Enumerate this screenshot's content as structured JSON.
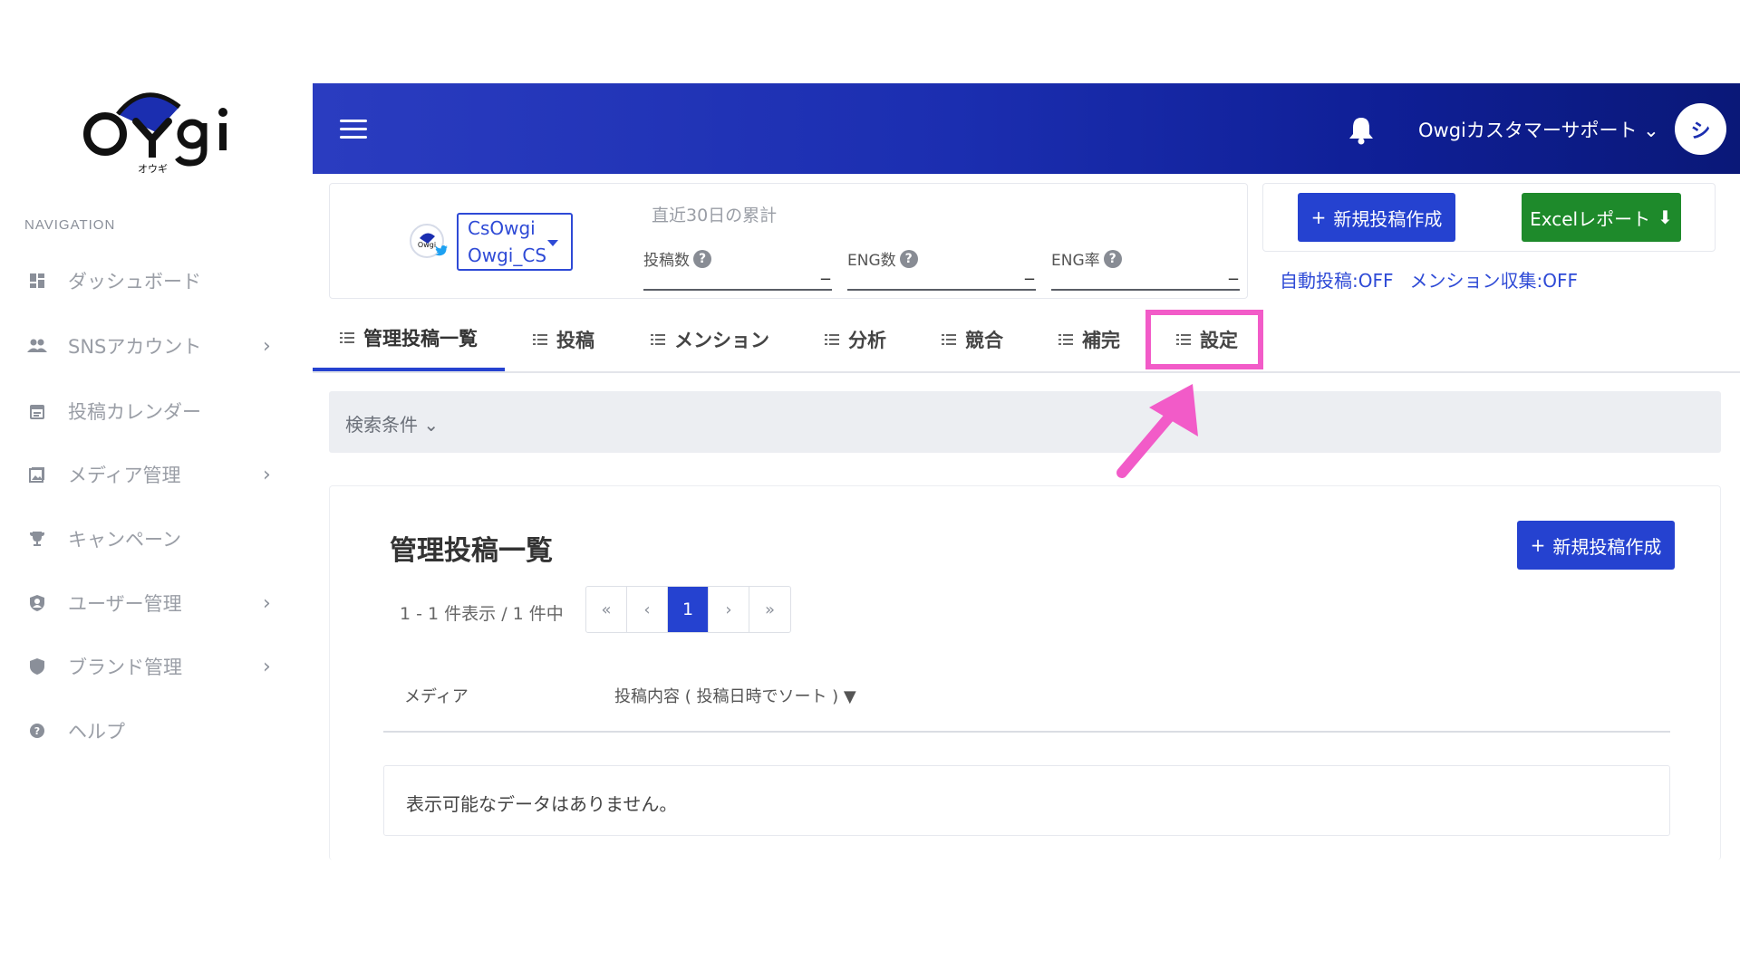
{
  "brand": {
    "logo_text": "Owgi",
    "logo_sub": "オウギ"
  },
  "sidebar": {
    "nav_title": "NAVIGATION",
    "items": [
      {
        "label": "ダッシュボード",
        "icon": "dashboard-icon",
        "has_children": false
      },
      {
        "label": "SNSアカウント",
        "icon": "people-icon",
        "has_children": true
      },
      {
        "label": "投稿カレンダー",
        "icon": "calendar-icon",
        "has_children": false
      },
      {
        "label": "メディア管理",
        "icon": "image-icon",
        "has_children": true
      },
      {
        "label": "キャンペーン",
        "icon": "trophy-icon",
        "has_children": false
      },
      {
        "label": "ユーザー管理",
        "icon": "user-shield-icon",
        "has_children": true
      },
      {
        "label": "ブランド管理",
        "icon": "shield-icon",
        "has_children": true
      },
      {
        "label": "ヘルプ",
        "icon": "help-icon",
        "has_children": false
      }
    ],
    "chevron": "›"
  },
  "header": {
    "user_name": "Owgiカスタマーサポート ⌄",
    "avatar_initial": "シ"
  },
  "account": {
    "name_line1": "CsOwgi",
    "name_line2": "Owgi_CS",
    "recent_label": "直近30日の累計",
    "metrics": [
      {
        "label": "投稿数",
        "value": "_"
      },
      {
        "label": "ENG数",
        "value": "_"
      },
      {
        "label": "ENG率",
        "value": "_"
      }
    ],
    "help_mark": "?"
  },
  "actions": {
    "new_post": "新規投稿作成",
    "excel_report": "Excelレポート",
    "plus": "+",
    "download": "⬇"
  },
  "status": {
    "auto_post": "自動投稿:OFF",
    "mention_collect": "メンション収集:OFF"
  },
  "tabs": [
    {
      "label": "管理投稿一覧",
      "active": true
    },
    {
      "label": "投稿",
      "active": false
    },
    {
      "label": "メンション",
      "active": false
    },
    {
      "label": "分析",
      "active": false
    },
    {
      "label": "競合",
      "active": false
    },
    {
      "label": "補完",
      "active": false
    },
    {
      "label": "設定",
      "active": false
    }
  ],
  "search": {
    "label": "検索条件 ⌄"
  },
  "list": {
    "title": "管理投稿一覧",
    "new_post": "新規投稿作成",
    "count_text": "1 - 1 件表示 / 1 件中",
    "pager": [
      "«",
      "‹",
      "1",
      "›",
      "»"
    ],
    "current_page": "1",
    "columns": [
      "メディア",
      "投稿内容 ( 投稿日時でソート ) ▼"
    ],
    "empty_message": "表示可能なデータはありません。"
  },
  "colors": {
    "primary": "#2542d0",
    "success": "#1e8a2b",
    "highlight": "#f25bc8",
    "header_start": "#2a3cc0",
    "header_end": "#0a1878"
  }
}
